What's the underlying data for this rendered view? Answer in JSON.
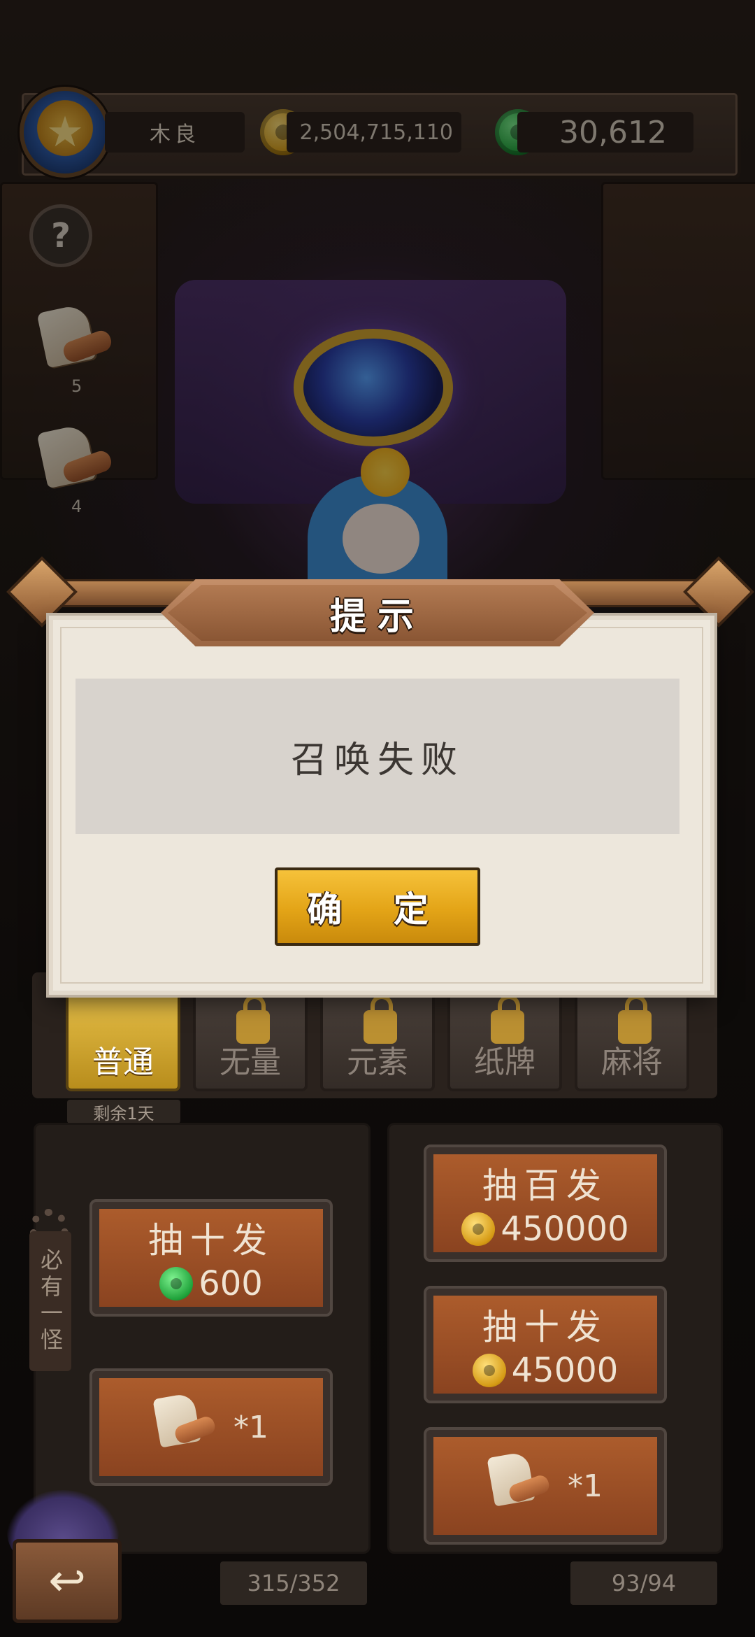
{
  "header": {
    "player_name": "木良",
    "gold_amount": "2,504,715,110",
    "jade_amount": "30,612",
    "help_label": "?"
  },
  "side_items": [
    {
      "icon": "gold-scroll-icon",
      "count": "5"
    },
    {
      "icon": "jade-scroll-icon",
      "count": "4"
    }
  ],
  "dialog": {
    "title": "提示",
    "message": "召唤失败",
    "confirm_label": "确 定"
  },
  "tabs": [
    {
      "label": "普通",
      "active": true,
      "locked": false
    },
    {
      "label": "无量",
      "active": false,
      "locked": true
    },
    {
      "label": "元素",
      "active": false,
      "locked": true
    },
    {
      "label": "纸牌",
      "active": false,
      "locked": true
    },
    {
      "label": "麻将",
      "active": false,
      "locked": true
    }
  ],
  "remaining_time": "剩余1天",
  "vertical_label": "必有一怪",
  "left_panel": {
    "draw_ten": {
      "label": "抽十发",
      "cost": "600",
      "currency": "jade"
    },
    "scroll_draw": {
      "mult": "*1",
      "icon": "jade-scroll-icon"
    },
    "counter": "315/352"
  },
  "right_panel": {
    "draw_hundred": {
      "label": "抽百发",
      "cost": "450000",
      "currency": "gold"
    },
    "draw_ten": {
      "label": "抽十发",
      "cost": "45000",
      "currency": "gold"
    },
    "scroll_draw": {
      "mult": "*1",
      "icon": "gold-scroll-icon"
    },
    "counter": "93/94"
  },
  "colors": {
    "accent_gold": "#e3a417",
    "button_brown": "#8a4320",
    "dialog_bg": "#ede7dc"
  }
}
